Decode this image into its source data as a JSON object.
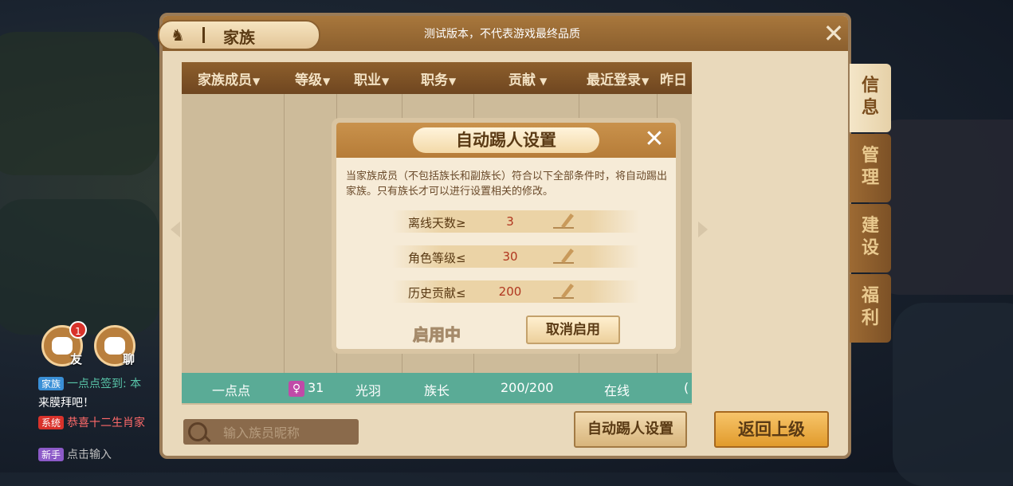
{
  "window": {
    "title": "家族",
    "notice": "测试版本，不代表游戏最终品质",
    "close_icon": "✕"
  },
  "side_tabs": [
    {
      "label": "信\n息",
      "active": true
    },
    {
      "label": "管\n理",
      "active": false
    },
    {
      "label": "建\n设",
      "active": false
    },
    {
      "label": "福\n利",
      "active": false
    }
  ],
  "table": {
    "headers": [
      "家族成员",
      "等级",
      "职业",
      "职务",
      "贡献",
      "最近登录",
      "昨日"
    ],
    "row": {
      "name": "一点点",
      "level": "31",
      "class": "光羽",
      "position": "族长",
      "contribution": "200/200",
      "last_login": "在线",
      "yesterday": "("
    }
  },
  "search": {
    "placeholder": "输入族员昵称"
  },
  "buttons": {
    "auto_kick": "自动踢人设置",
    "back": "返回上级"
  },
  "hud": {
    "friend_label": "友",
    "friend_badge": "1",
    "chat_label": "聊"
  },
  "chat": [
    {
      "tag": "家族",
      "tag_color": "#3a8fd6",
      "text": "一点点签到: 本",
      "text_color": "#58c4a8"
    },
    {
      "tag": "",
      "tag_color": "",
      "text": "来膜拜吧！",
      "text_color": "#ffffff"
    },
    {
      "tag": "系统",
      "tag_color": "#d9322b",
      "text": "恭喜十二生肖家",
      "text_color": "#ff6a6a"
    },
    {
      "tag": "新手",
      "tag_color": "#8c5ac8",
      "text": "点击输入",
      "text_color": "#bfbfbf"
    }
  ],
  "modal": {
    "title": "自动踢人设置",
    "description": "当家族成员（不包括族长和副族长）符合以下全部条件时，将自动踢出家族。只有族长才可以进行设置相关的修改。",
    "conditions": [
      {
        "label": "离线天数≥",
        "value": "3"
      },
      {
        "label": "角色等级≤",
        "value": "30"
      },
      {
        "label": "历史贡献≤",
        "value": "200"
      }
    ],
    "status": "启用中",
    "cancel_button": "取消启用"
  }
}
